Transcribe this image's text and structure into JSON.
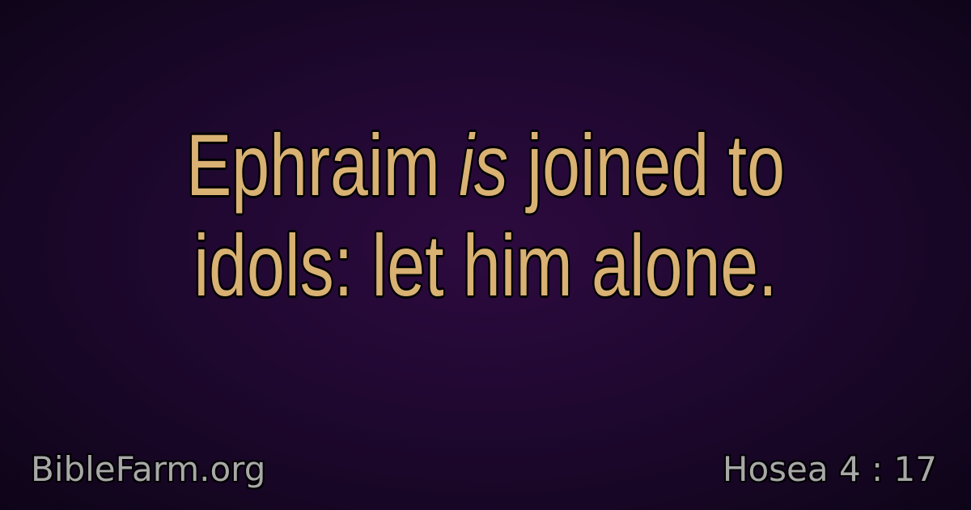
{
  "verse": {
    "line1_before": "Ephraim ",
    "line1_italic": "is",
    "line1_after": " joined to",
    "line2": "idols: let him alone."
  },
  "footer": {
    "site": "BibleFarm.org",
    "reference": "Hosea 4 : 17"
  },
  "colors": {
    "verse_text": "#d8b173",
    "footer_text": "#a8a8a8",
    "background_center": "#2d0a3f",
    "background_edge": "#0e0418"
  }
}
